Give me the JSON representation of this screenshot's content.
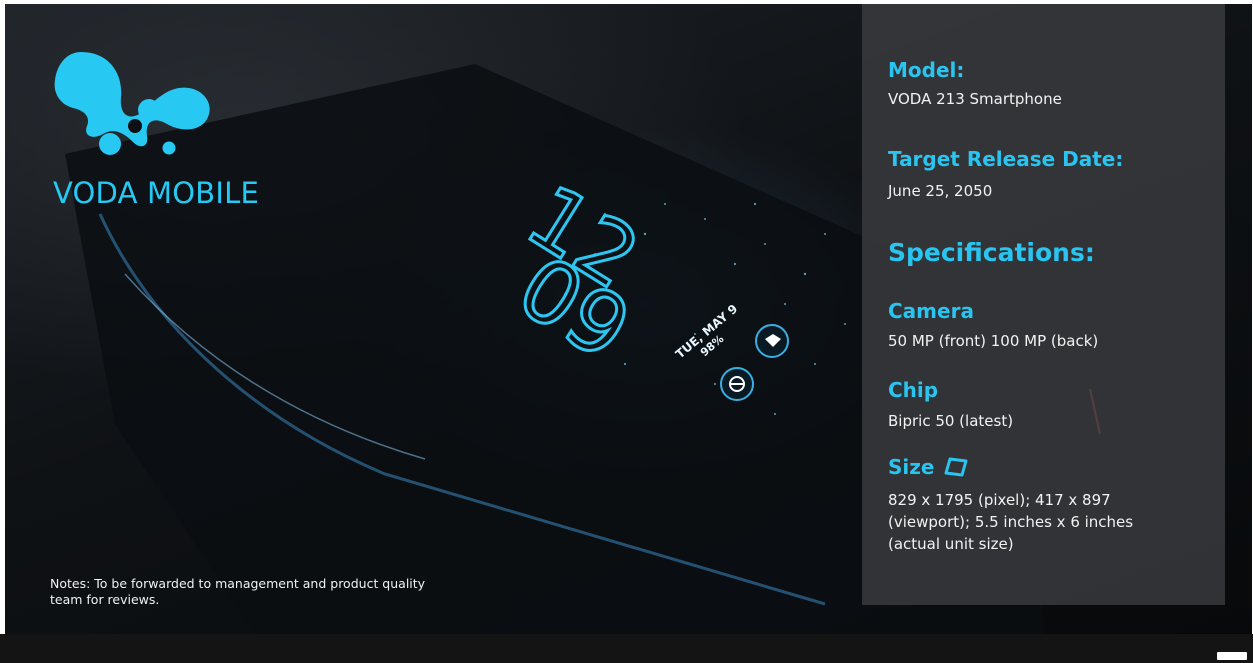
{
  "brand": {
    "name": "VODA MOBILE"
  },
  "notes": "Notes: To be forwarded to management and product quality team for reviews.",
  "phone_screen": {
    "time_hour": "12",
    "time_minute": "09",
    "date": "TUE, MAY 9",
    "battery": "98%"
  },
  "specs": {
    "model_heading": "Model:",
    "model_value": "VODA 213 Smartphone",
    "date_heading": "Target Release Date:",
    "date_value": "June 25, 2050",
    "specs_heading": "Specifications:",
    "camera_heading": "Camera",
    "camera_value": "50 MP (front) 100 MP (back)",
    "chip_heading": "Chip",
    "chip_value": "Bipric 50 (latest)",
    "size_heading": "Size",
    "size_value": "829 x 1795 (pixel); 417 x 897 (viewport); 5.5 inches x 6 inches (actual unit size)"
  },
  "colors": {
    "accent": "#29c5f0",
    "panel": "#3a3c3f",
    "background": "#0c0f12"
  },
  "icons": {
    "logo": "splash-logo",
    "size_icon": "diamond-outline-icon"
  }
}
